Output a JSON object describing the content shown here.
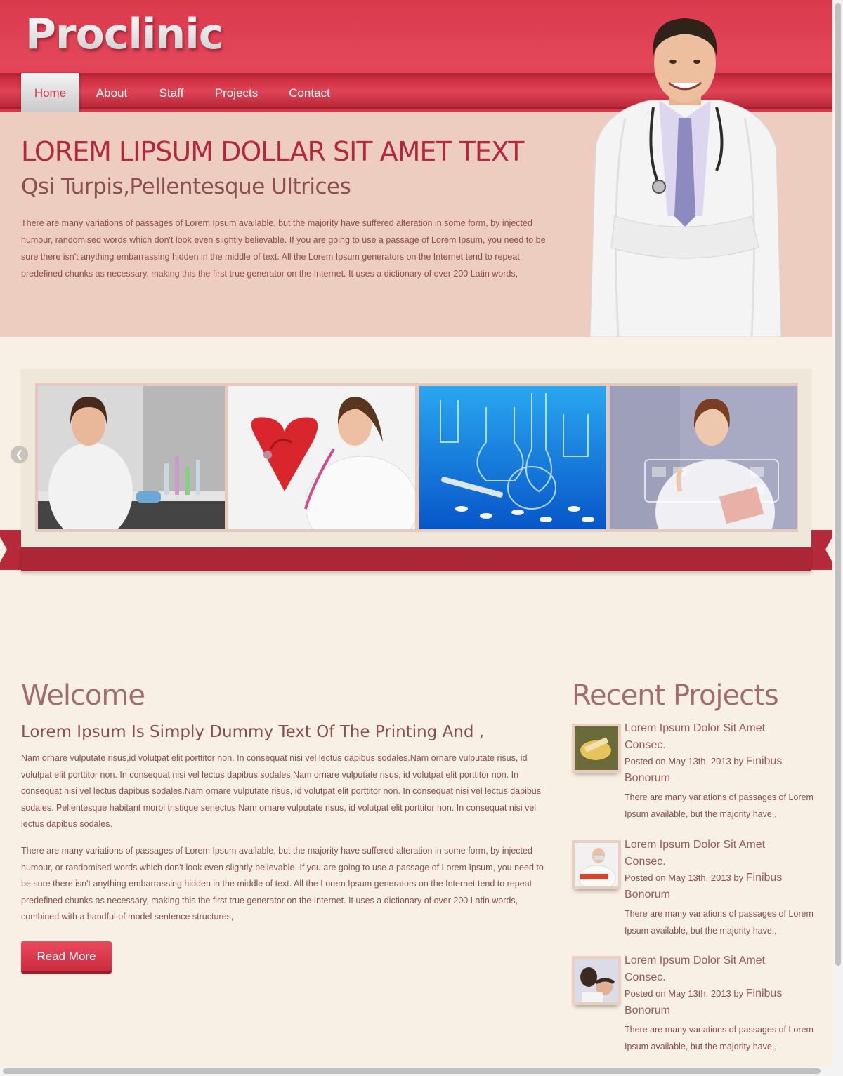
{
  "header": {
    "logo": "Proclinic",
    "nav": [
      {
        "label": "Home"
      },
      {
        "label": "About"
      },
      {
        "label": "Staff"
      },
      {
        "label": "Projects"
      },
      {
        "label": "Contact"
      }
    ]
  },
  "hero": {
    "title": "LOREM LIPSUM DOLLAR SIT AMET TEXT",
    "subtitle": "Qsi Turpis,Pellentesque Ultrices",
    "text": "There are many variations of passages of Lorem Ipsum available, but the majority have suffered alteration in some form, by injected humour, randomised words which don't look even slightly believable. If you are going to use a passage of Lorem Ipsum, you need to be sure there isn't anything embarrassing hidden in the middle of text. All the Lorem Ipsum generators on the Internet tend to repeat predefined chunks as necessary, making this the first true generator on the Internet. It uses a dictionary of over 200 Latin words,"
  },
  "slider": {
    "prev_icon": "chevron-left-icon",
    "slides": [
      {
        "name": "lab-scientist"
      },
      {
        "name": "doctor-with-heart"
      },
      {
        "name": "lab-glassware"
      },
      {
        "name": "doctor-touchscreen"
      }
    ]
  },
  "welcome": {
    "title": "Welcome",
    "subtitle": "Lorem Ipsum Is Simply Dummy Text Of The Printing And ,",
    "para1": "Nam ornare vulputate risus,id volutpat elit porttitor non. In consequat nisi vel lectus dapibus sodales.Nam ornare vulputate risus, id volutpat elit porttitor non. In consequat nisi vel lectus dapibus sodales.Nam ornare vulputate risus, id volutpat elit porttitor non. In consequat nisi vel lectus dapibus sodales.Nam ornare vulputate risus, id volutpat elit porttitor non. In consequat nisi vel lectus dapibus sodales. Pellentesque habitant morbi tristique senectus Nam ornare vulputate risus, id volutpat elit porttitor non. In consequat nisi vel lectus dapibus sodales.",
    "para2": "There are many variations of passages of Lorem Ipsum available, but the majority have suffered alteration in some form, by injected humour, or randomised words which don't look even slightly believable. If you are going to use a passage of Lorem Ipsum, you need to be sure there isn't anything embarrassing hidden in the middle of text. All the Lorem Ipsum generators on the Internet tend to repeat predefined chunks as necessary, making this the first true generator on the Internet. It uses a dictionary of over 200 Latin words, combined with a handful of model sentence structures,",
    "read_more": "Read More"
  },
  "recent_projects": {
    "title": "Recent Projects",
    "items": [
      {
        "title": "Lorem Ipsum Dolor Sit Amet Consec.",
        "posted": "Posted on May 13th, 2013 by",
        "author": "Finibus Bonorum",
        "desc": "There are many variations of passages of Lorem Ipsum available, but the majority have,,"
      },
      {
        "title": "Lorem Ipsum Dolor Sit Amet Consec.",
        "posted": "Posted on May 13th, 2013 by",
        "author": "Finibus Bonorum",
        "desc": "There are many variations of passages of Lorem Ipsum available, but the majority have,,"
      },
      {
        "title": "Lorem Ipsum Dolor Sit Amet Consec.",
        "posted": "Posted on May 13th, 2013 by",
        "author": "Finibus Bonorum",
        "desc": "There are many variations of passages of Lorem Ipsum available, but the majority have,,"
      }
    ]
  },
  "colors": {
    "brand_red": "#d93a4c",
    "ribbon_red": "#ab2637",
    "hero_bg": "#edcdbf",
    "page_bg": "#f8f0e4"
  }
}
